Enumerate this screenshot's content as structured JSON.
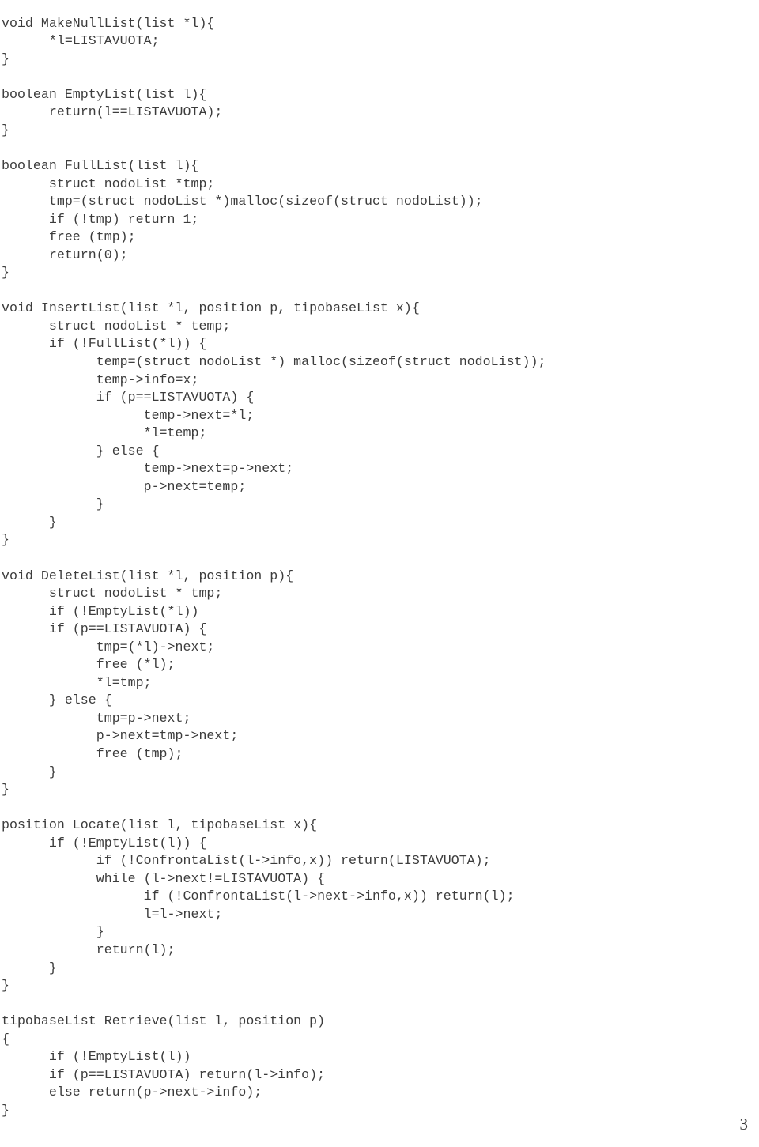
{
  "document": {
    "page_number": "3",
    "language": "c",
    "text_color": "#3c3c3c",
    "background_color": "#ffffff"
  },
  "code": {
    "lines": [
      "void MakeNullList(list *l){",
      "      *l=LISTAVUOTA;",
      "}",
      "",
      "boolean EmptyList(list l){",
      "      return(l==LISTAVUOTA);",
      "}",
      "",
      "boolean FullList(list l){",
      "      struct nodoList *tmp;",
      "      tmp=(struct nodoList *)malloc(sizeof(struct nodoList));",
      "      if (!tmp) return 1;",
      "      free (tmp);",
      "      return(0);",
      "}",
      "",
      "void InsertList(list *l, position p, tipobaseList x){",
      "      struct nodoList * temp;",
      "      if (!FullList(*l)) {",
      "            temp=(struct nodoList *) malloc(sizeof(struct nodoList));",
      "            temp->info=x;",
      "            if (p==LISTAVUOTA) {",
      "                  temp->next=*l;",
      "                  *l=temp;",
      "            } else {",
      "                  temp->next=p->next;",
      "                  p->next=temp;",
      "            }",
      "      }",
      "}",
      "",
      "void DeleteList(list *l, position p){",
      "      struct nodoList * tmp;",
      "      if (!EmptyList(*l))",
      "      if (p==LISTAVUOTA) {",
      "            tmp=(*l)->next;",
      "            free (*l);",
      "            *l=tmp;",
      "      } else {",
      "            tmp=p->next;",
      "            p->next=tmp->next;",
      "            free (tmp);",
      "      }",
      "}",
      "",
      "position Locate(list l, tipobaseList x){",
      "      if (!EmptyList(l)) {",
      "            if (!ConfrontaList(l->info,x)) return(LISTAVUOTA);",
      "            while (l->next!=LISTAVUOTA) {",
      "                  if (!ConfrontaList(l->next->info,x)) return(l);",
      "                  l=l->next;",
      "            }",
      "            return(l);",
      "      }",
      "}",
      "",
      "tipobaseList Retrieve(list l, position p)",
      "{",
      "      if (!EmptyList(l))",
      "      if (p==LISTAVUOTA) return(l->info);",
      "      else return(p->next->info);",
      "}"
    ]
  }
}
